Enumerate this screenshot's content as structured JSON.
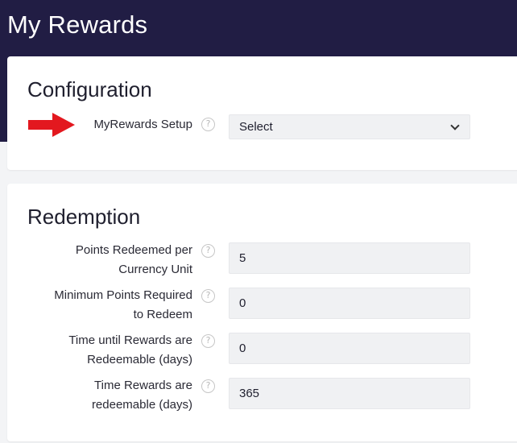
{
  "header": {
    "title": "My Rewards"
  },
  "configuration": {
    "title": "Configuration",
    "setup_label": "MyRewards Setup",
    "setup_value": "Select",
    "help_glyph": "?"
  },
  "redemption": {
    "title": "Redemption",
    "fields": [
      {
        "label_line1": "Points Redeemed per",
        "label_line2": "Currency Unit",
        "value": "5"
      },
      {
        "label_line1": "Minimum Points Required",
        "label_line2": "to Redeem",
        "value": "0"
      },
      {
        "label_line1": "Time until Rewards are",
        "label_line2": "Redeemable (days)",
        "value": "0"
      },
      {
        "label_line1": "Time Rewards are",
        "label_line2": "redeemable (days)",
        "value": "365"
      }
    ]
  },
  "colors": {
    "header_bg": "#211d44",
    "annotation_arrow": "#e3181f"
  },
  "icons": [
    "help-icon",
    "chevron-down-icon",
    "red-arrow-annotation"
  ]
}
